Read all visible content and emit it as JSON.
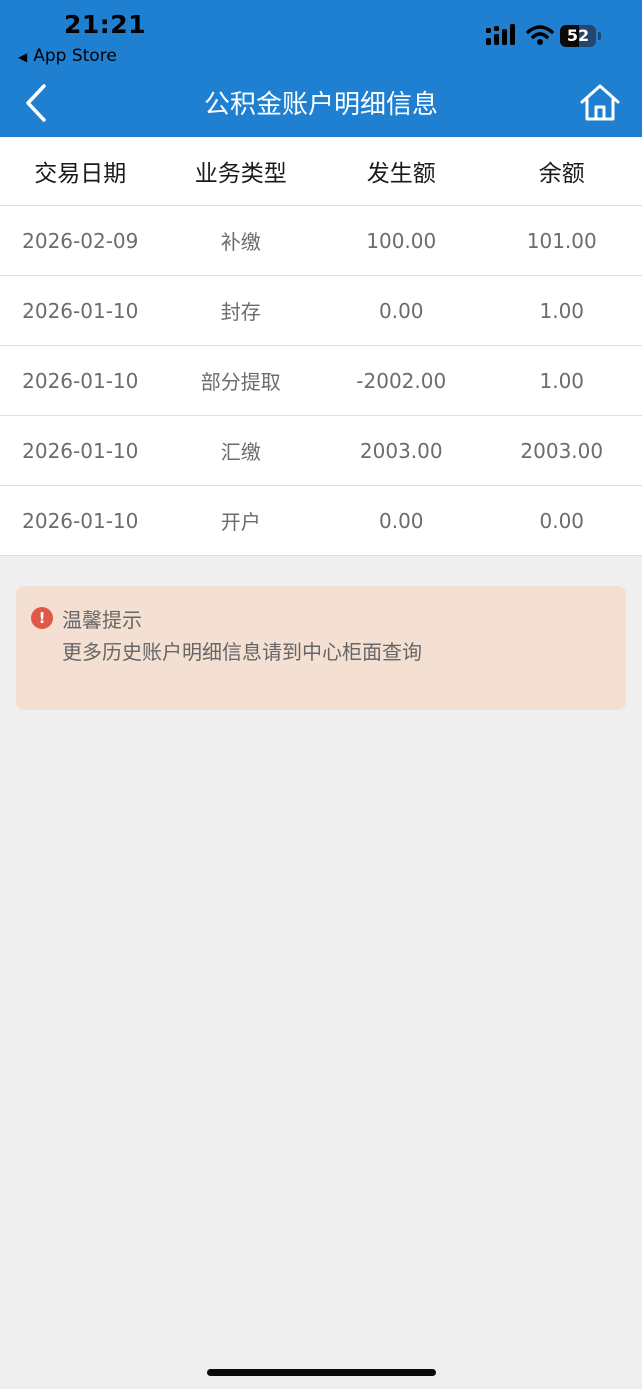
{
  "status_bar": {
    "time": "21:21",
    "back_label": "App Store",
    "battery_level": "52",
    "battery_fraction": 0.52
  },
  "nav": {
    "title": "公积金账户明细信息",
    "back_icon": "chevron-left-icon",
    "home_icon": "home-icon"
  },
  "table": {
    "headers": [
      "交易日期",
      "业务类型",
      "发生额",
      "余额"
    ],
    "rows": [
      [
        "2026-02-09",
        "补缴",
        "100.00",
        "101.00"
      ],
      [
        "2026-01-10",
        "封存",
        "0.00",
        "1.00"
      ],
      [
        "2026-01-10",
        "部分提取",
        "-2002.00",
        "1.00"
      ],
      [
        "2026-01-10",
        "汇缴",
        "2003.00",
        "2003.00"
      ],
      [
        "2026-01-10",
        "开户",
        "0.00",
        "0.00"
      ]
    ]
  },
  "notice": {
    "icon": "alert-icon",
    "title": "温馨提示",
    "text": "更多历史账户明细信息请到中心柜面查询"
  },
  "colors": {
    "header_blue": "#1f80d2",
    "notice_bg": "#f4e0d2",
    "alert_red": "#e0584a",
    "page_bg": "#efefef"
  }
}
